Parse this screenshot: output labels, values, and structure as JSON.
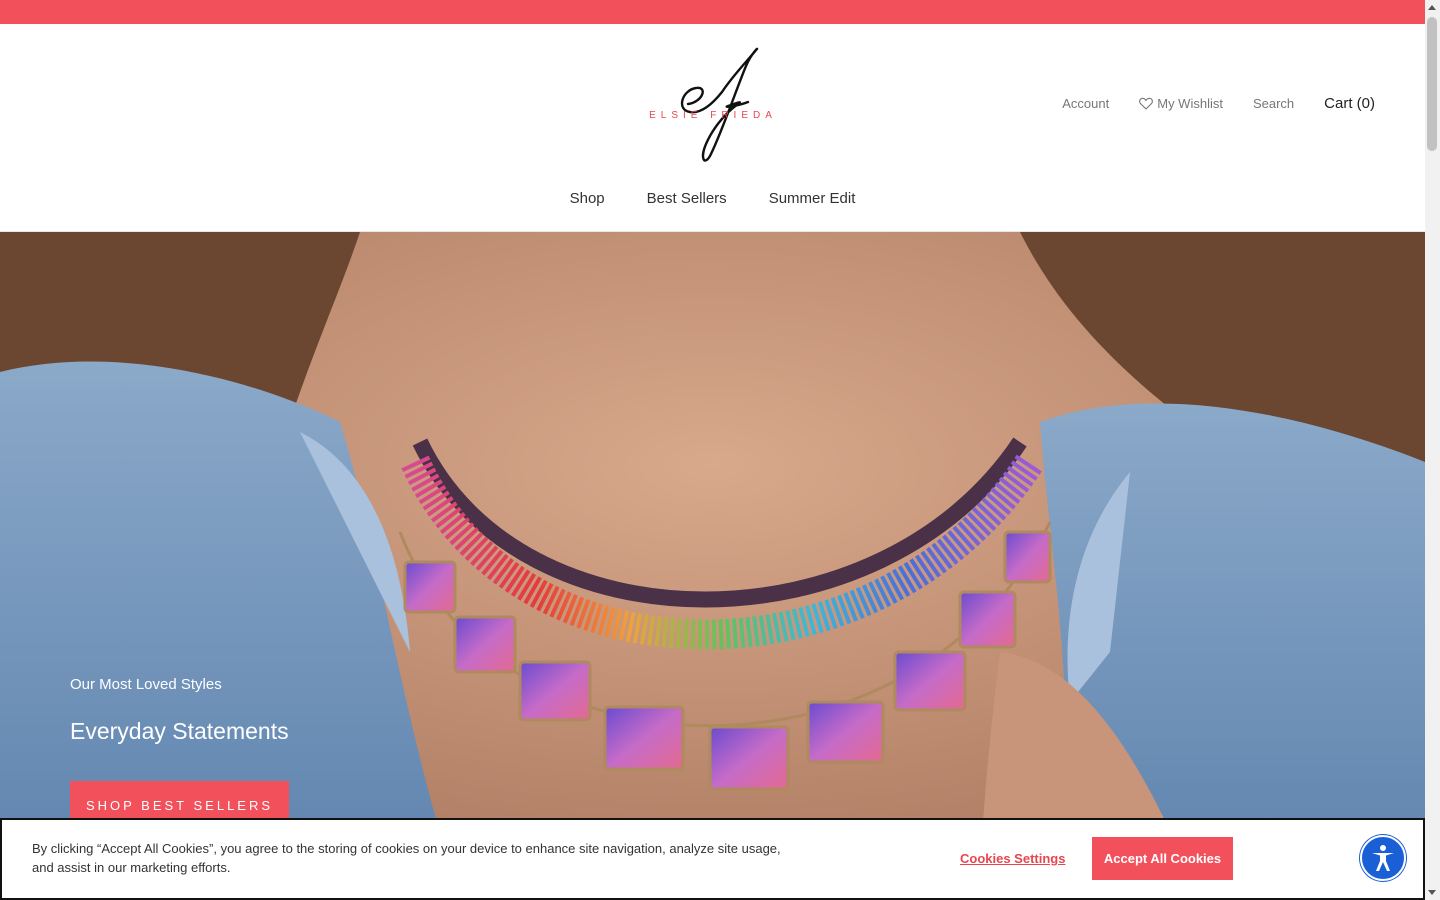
{
  "colors": {
    "brand_red": "#f2505a",
    "accessibility_blue": "#1a5fd6"
  },
  "brand": {
    "logo_monogram": "ef",
    "logo_wordmark": "ELSIE FRIEDA"
  },
  "header": {
    "account": "Account",
    "wishlist": "My Wishlist",
    "search": "Search",
    "cart": "Cart (0)"
  },
  "nav": {
    "items": [
      "Shop",
      "Best Sellers",
      "Summer Edit"
    ]
  },
  "hero": {
    "subtitle": "Our Most Loved Styles",
    "title": "Everyday Statements",
    "button": "SHOP BEST SELLERS"
  },
  "cookie_banner": {
    "text": "By clicking “Accept All Cookies”, you agree to the storing of cookies on your device to enhance site navigation, analyze site usage, and assist in our marketing efforts.",
    "settings_label": "Cookies Settings",
    "accept_label": "Accept All Cookies"
  },
  "icons": {
    "wishlist": "heart-icon",
    "accessibility": "accessibility-icon"
  }
}
